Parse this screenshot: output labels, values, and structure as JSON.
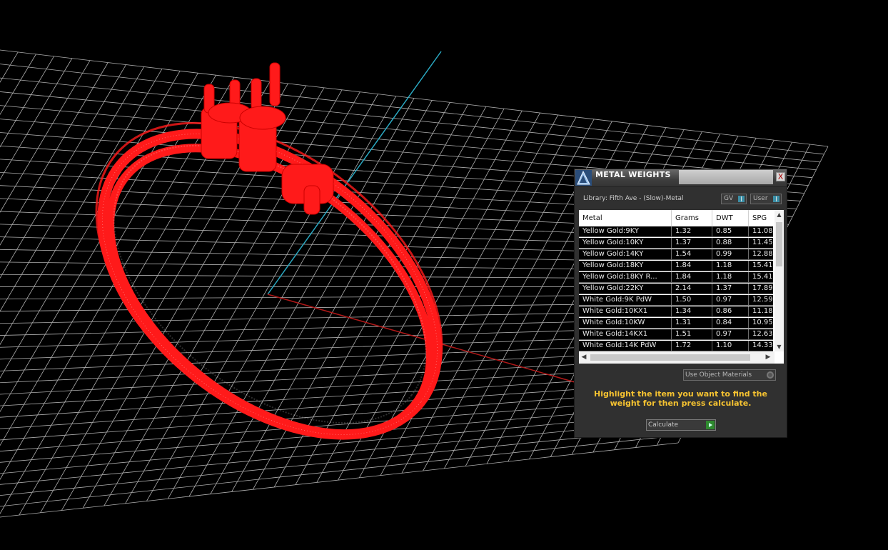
{
  "panel": {
    "title": "METAL WEIGHTS",
    "close_glyph": "X",
    "library": "Library: Fifth Ave - (Slow)-Metal",
    "toggle_gv": "GV",
    "toggle_user": "User",
    "use_object_materials": "Use Object Materials",
    "instructions": "Highlight the item you want to find the weight for then press calculate.",
    "calculate": "Calculate"
  },
  "table": {
    "columns": [
      "Metal",
      "Grams",
      "DWT",
      "SPG"
    ],
    "rows": [
      {
        "metal": "Yellow Gold:9KY",
        "grams": "1.32",
        "dwt": "0.85",
        "spg": "11.08"
      },
      {
        "metal": "Yellow Gold:10KY",
        "grams": "1.37",
        "dwt": "0.88",
        "spg": "11.45"
      },
      {
        "metal": "Yellow Gold:14KY",
        "grams": "1.54",
        "dwt": "0.99",
        "spg": "12.88"
      },
      {
        "metal": "Yellow Gold:18KY",
        "grams": "1.84",
        "dwt": "1.18",
        "spg": "15.41"
      },
      {
        "metal": "Yellow Gold:18KY R...",
        "grams": "1.84",
        "dwt": "1.18",
        "spg": "15.41"
      },
      {
        "metal": "Yellow Gold:22KY",
        "grams": "2.14",
        "dwt": "1.37",
        "spg": "17.89"
      },
      {
        "metal": "White Gold:9K PdW",
        "grams": "1.50",
        "dwt": "0.97",
        "spg": "12.59"
      },
      {
        "metal": "White Gold:10KX1",
        "grams": "1.34",
        "dwt": "0.86",
        "spg": "11.18"
      },
      {
        "metal": "White Gold:10KW",
        "grams": "1.31",
        "dwt": "0.84",
        "spg": "10.95"
      },
      {
        "metal": "White Gold:14KX1",
        "grams": "1.51",
        "dwt": "0.97",
        "spg": "12.63"
      },
      {
        "metal": "White Gold:14K PdW",
        "grams": "1.72",
        "dwt": "1.10",
        "spg": "14.33"
      }
    ]
  },
  "colors": {
    "viewport_bg": "#000000",
    "grid": "#cfcfcf",
    "axis_y": "#2aa7c0",
    "axis_x": "#b01818",
    "model": "#ff1a1a",
    "instruction_text": "#f6c331"
  }
}
